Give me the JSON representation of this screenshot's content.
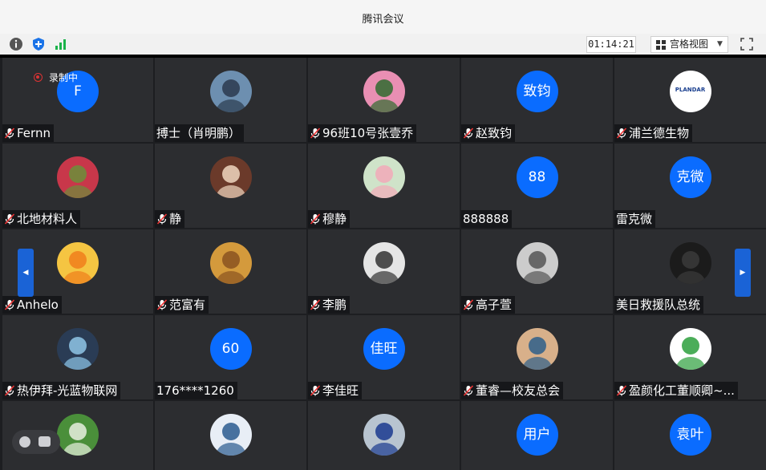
{
  "window": {
    "title": "腾讯会议"
  },
  "toolbar": {
    "timer": "01:14:21",
    "view_label": "宫格视图",
    "info_icon": "info-icon",
    "shield_icon": "shield-icon",
    "signal_icon": "signal-icon"
  },
  "recording": {
    "label": "录制中"
  },
  "accent": "#0a6cff",
  "participants": [
    {
      "name": "Fernn",
      "avatar": "F",
      "muted": true
    },
    {
      "name": "搏士（肖明鹏）",
      "avatar": "photo",
      "muted": false
    },
    {
      "name": "96班10号张壹乔",
      "avatar": "photo",
      "muted": true
    },
    {
      "name": "赵致钧",
      "avatar": "致钧",
      "muted": true
    },
    {
      "name": "浦兰德生物",
      "avatar": "photo",
      "muted": true
    },
    {
      "name": "北地材料人",
      "avatar": "photo",
      "muted": true
    },
    {
      "name": "静",
      "avatar": "photo",
      "muted": true
    },
    {
      "name": "穆静",
      "avatar": "photo",
      "muted": true
    },
    {
      "name": "888888",
      "avatar": "88",
      "muted": false
    },
    {
      "name": "雷克微",
      "avatar": "克微",
      "muted": false
    },
    {
      "name": "Anhelo",
      "avatar": "photo",
      "muted": true
    },
    {
      "name": "范富有",
      "avatar": "photo",
      "muted": true
    },
    {
      "name": "李鹏",
      "avatar": "photo",
      "muted": true
    },
    {
      "name": "高子萱",
      "avatar": "photo",
      "muted": true
    },
    {
      "name": "美日救援队总统",
      "avatar": "photo",
      "muted": false
    },
    {
      "name": "热伊拜-光蓝物联网",
      "avatar": "photo",
      "muted": true
    },
    {
      "name": "176****1260",
      "avatar": "60",
      "muted": false
    },
    {
      "name": "李佳旺",
      "avatar": "佳旺",
      "muted": true
    },
    {
      "name": "董睿—校友总会",
      "avatar": "photo",
      "muted": true
    },
    {
      "name": "盈颜化工董顺卿~...",
      "avatar": "photo",
      "muted": true
    },
    {
      "name": "",
      "avatar": "photo",
      "muted": false
    },
    {
      "name": "",
      "avatar": "photo",
      "muted": false
    },
    {
      "name": "",
      "avatar": "photo",
      "muted": false
    },
    {
      "name": "",
      "avatar": "用户",
      "muted": false
    },
    {
      "name": "",
      "avatar": "袁叶",
      "muted": false
    }
  ],
  "logo_text": "PLANDAR"
}
